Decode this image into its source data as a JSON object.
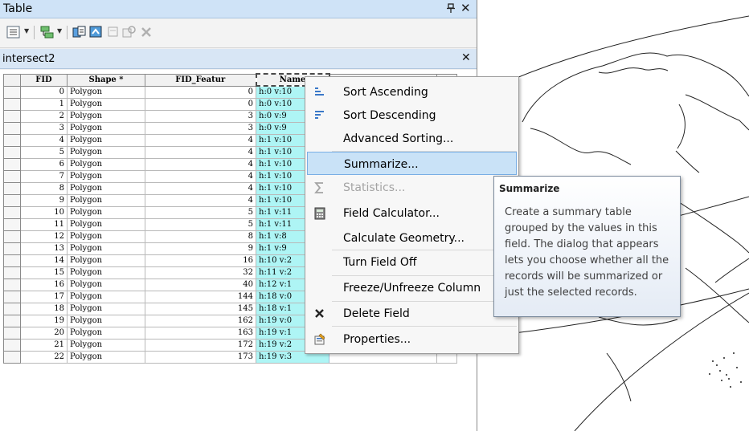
{
  "window": {
    "title": "Table",
    "pin_glyph": "▢",
    "close_glyph": "✕"
  },
  "table_tab": {
    "name": "intersect2",
    "close_glyph": "✕"
  },
  "grid": {
    "columns": [
      "FID",
      "Shape *",
      "FID_Featur",
      "Name",
      "",
      ""
    ],
    "rows": [
      {
        "fid": "0",
        "shape": "Polygon",
        "fid_featur": "0",
        "name": "h:0 v:10"
      },
      {
        "fid": "1",
        "shape": "Polygon",
        "fid_featur": "0",
        "name": "h:0 v:10"
      },
      {
        "fid": "2",
        "shape": "Polygon",
        "fid_featur": "3",
        "name": "h:0 v:9"
      },
      {
        "fid": "3",
        "shape": "Polygon",
        "fid_featur": "3",
        "name": "h:0 v:9"
      },
      {
        "fid": "4",
        "shape": "Polygon",
        "fid_featur": "4",
        "name": "h:1 v:10"
      },
      {
        "fid": "5",
        "shape": "Polygon",
        "fid_featur": "4",
        "name": "h:1 v:10"
      },
      {
        "fid": "6",
        "shape": "Polygon",
        "fid_featur": "4",
        "name": "h:1 v:10"
      },
      {
        "fid": "7",
        "shape": "Polygon",
        "fid_featur": "4",
        "name": "h:1 v:10"
      },
      {
        "fid": "8",
        "shape": "Polygon",
        "fid_featur": "4",
        "name": "h:1 v:10"
      },
      {
        "fid": "9",
        "shape": "Polygon",
        "fid_featur": "4",
        "name": "h:1 v:10"
      },
      {
        "fid": "10",
        "shape": "Polygon",
        "fid_featur": "5",
        "name": "h:1 v:11"
      },
      {
        "fid": "11",
        "shape": "Polygon",
        "fid_featur": "5",
        "name": "h:1 v:11"
      },
      {
        "fid": "12",
        "shape": "Polygon",
        "fid_featur": "8",
        "name": "h:1 v:8"
      },
      {
        "fid": "13",
        "shape": "Polygon",
        "fid_featur": "9",
        "name": "h:1 v:9"
      },
      {
        "fid": "14",
        "shape": "Polygon",
        "fid_featur": "16",
        "name": "h:10 v:2"
      },
      {
        "fid": "15",
        "shape": "Polygon",
        "fid_featur": "32",
        "name": "h:11 v:2"
      },
      {
        "fid": "16",
        "shape": "Polygon",
        "fid_featur": "40",
        "name": "h:12 v:1"
      },
      {
        "fid": "17",
        "shape": "Polygon",
        "fid_featur": "144",
        "name": "h:18 v:0"
      },
      {
        "fid": "18",
        "shape": "Polygon",
        "fid_featur": "145",
        "name": "h:18 v:1"
      },
      {
        "fid": "19",
        "shape": "Polygon",
        "fid_featur": "162",
        "name": "h:19 v:0"
      },
      {
        "fid": "20",
        "shape": "Polygon",
        "fid_featur": "163",
        "name": "h:19 v:1"
      },
      {
        "fid": "21",
        "shape": "Polygon",
        "fid_featur": "172",
        "name": "h:19 v:2"
      },
      {
        "fid": "22",
        "shape": "Polygon",
        "fid_featur": "173",
        "name": "h:19 v:3"
      }
    ]
  },
  "context_menu": {
    "items": [
      {
        "label": "Sort Ascending",
        "icon": "sort-ascending-icon",
        "enabled": true
      },
      {
        "label": "Sort Descending",
        "icon": "sort-descending-icon",
        "enabled": true
      },
      {
        "label": "Advanced Sorting...",
        "icon": "",
        "enabled": true
      },
      {
        "label": "Summarize...",
        "icon": "",
        "enabled": true,
        "hovered": true
      },
      {
        "label": "Statistics...",
        "icon": "sigma-icon",
        "enabled": false
      },
      {
        "label": "Field Calculator...",
        "icon": "calculator-icon",
        "enabled": true
      },
      {
        "label": "Calculate Geometry...",
        "icon": "",
        "enabled": true
      },
      {
        "label": "Turn Field Off",
        "icon": "",
        "enabled": true
      },
      {
        "label": "Freeze/Unfreeze Column",
        "icon": "",
        "enabled": true
      },
      {
        "label": "Delete Field",
        "icon": "delete-x-icon",
        "enabled": true
      },
      {
        "label": "Properties...",
        "icon": "properties-icon",
        "enabled": true
      }
    ]
  },
  "tooltip": {
    "title": "Summarize",
    "body_lines": [
      "Create a summary table",
      "grouped by the values in this",
      "field. The dialog that appears",
      "lets you choose whether all the",
      "records will be summarized or",
      "just the selected records."
    ]
  },
  "colors": {
    "title_bar": "#cfe3f7",
    "selected_cell": "#aef5f5",
    "menu_hover": "#c9e2f7",
    "tooltip_border": "#7a8a9c"
  }
}
